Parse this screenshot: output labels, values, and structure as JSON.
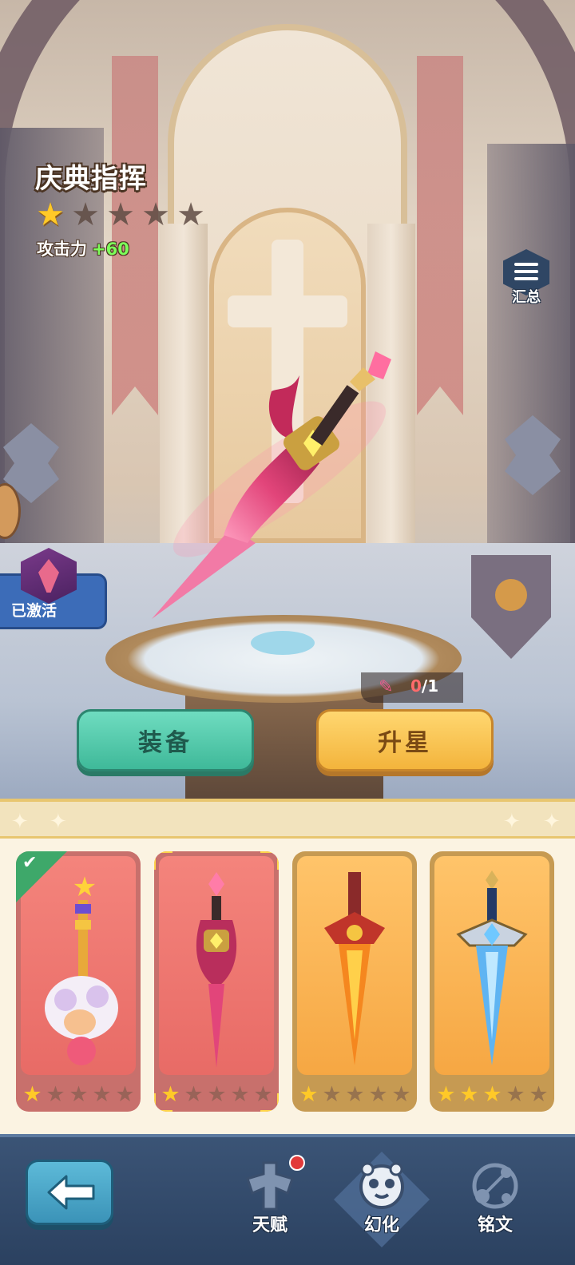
{
  "weapon": {
    "name": "庆典指挥",
    "stars_total": 5,
    "stars_lit": 1,
    "attack_label": "攻击力",
    "attack_bonus": "+60",
    "shard_count": "0",
    "shard_needed": "/1",
    "accent_color": "#e2457a"
  },
  "buttons": {
    "summary_label": "汇总",
    "activated_label": "已激活",
    "equip_label": "装备",
    "star_up_label": "升星"
  },
  "collection": [
    {
      "name": "sheep-scepter",
      "rarity": "red",
      "stars_lit": 1,
      "equipped": true,
      "selected": false
    },
    {
      "name": "celebration-baton",
      "rarity": "red",
      "stars_lit": 1,
      "equipped": false,
      "selected": true
    },
    {
      "name": "flame-sword",
      "rarity": "gold",
      "stars_lit": 1,
      "equipped": false,
      "selected": false
    },
    {
      "name": "ice-sword",
      "rarity": "gold",
      "stars_lit": 3,
      "equipped": false,
      "selected": false
    }
  ],
  "nav": {
    "tabs": [
      {
        "label": "天赋",
        "icon": "talent-icon",
        "has_notification": true,
        "active": false
      },
      {
        "label": "幻化",
        "icon": "transform-icon",
        "has_notification": false,
        "active": true
      },
      {
        "label": "铭文",
        "icon": "inscription-icon",
        "has_notification": false,
        "active": false
      }
    ]
  }
}
